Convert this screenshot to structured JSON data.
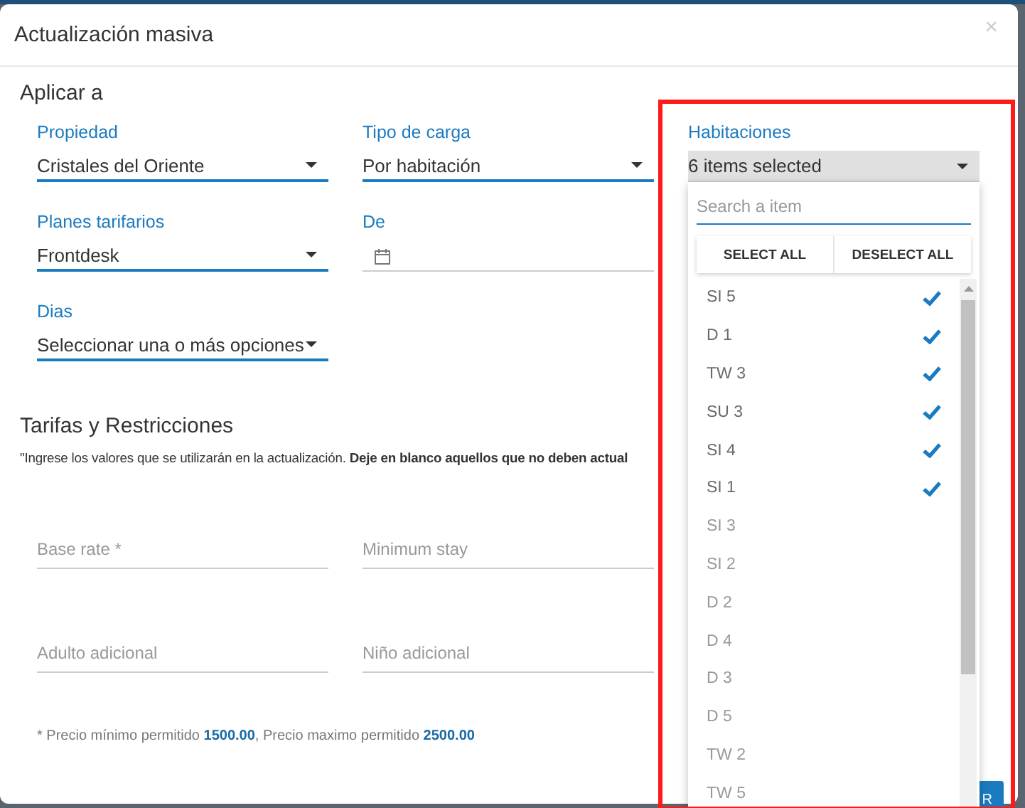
{
  "dialog": {
    "title": "Actualización masiva",
    "close": "×"
  },
  "apply_to": {
    "title": "Aplicar a",
    "rows": [
      [
        {
          "kind": "select",
          "label": "Propiedad",
          "value": "Cristales del Oriente"
        },
        {
          "kind": "select",
          "label": "Tipo de carga",
          "value": "Por habitación"
        },
        {
          "kind": "multiselect",
          "label": "Habitaciones",
          "value": "6 items selected",
          "open": true
        }
      ],
      [
        {
          "kind": "select",
          "label": "Planes tarifarios",
          "value": "Frontdesk"
        },
        {
          "kind": "date",
          "label": "De"
        }
      ],
      [
        {
          "kind": "select",
          "label": "Dias",
          "value": "Seleccionar una o más opciones"
        }
      ]
    ]
  },
  "rates": {
    "title": "Tarifas y Restricciones",
    "note": "\"Ingrese los valores que se utilizarán en la actualización. **Deje en blanco aquellos que no deben actual**",
    "rows": [
      [
        {
          "placeholder": "Base rate *"
        },
        {
          "placeholder": "Minimum stay"
        }
      ],
      [
        {
          "placeholder": "Adulto adicional"
        },
        {
          "placeholder": "Niño adicional"
        }
      ]
    ],
    "limits": [
      {
        "text": "* Precio mínimo permitido ",
        "kind": "plain"
      },
      {
        "text": "1500.00",
        "kind": "value"
      },
      {
        "text": ", Precio maximo permitido ",
        "kind": "plain"
      },
      {
        "text": "2500.00",
        "kind": "value"
      }
    ]
  },
  "footer_button": "R",
  "dropdown": {
    "search_placeholder": "Search a item",
    "actions": [
      "SELECT ALL",
      "DESELECT ALL"
    ],
    "items": [
      {
        "label": "SI 5",
        "selected": true
      },
      {
        "label": "D 1",
        "selected": true
      },
      {
        "label": "TW 3",
        "selected": true
      },
      {
        "label": "SU 3",
        "selected": true
      },
      {
        "label": "SI 4",
        "selected": true
      },
      {
        "label": "SI 1",
        "selected": true
      },
      {
        "label": "SI 3",
        "selected": false
      },
      {
        "label": "SI 2",
        "selected": false
      },
      {
        "label": "D 2",
        "selected": false
      },
      {
        "label": "D 4",
        "selected": false
      },
      {
        "label": "D 3",
        "selected": false
      },
      {
        "label": "D 5",
        "selected": false
      },
      {
        "label": "TW 2",
        "selected": false
      },
      {
        "label": "TW 5",
        "selected": false
      }
    ]
  }
}
